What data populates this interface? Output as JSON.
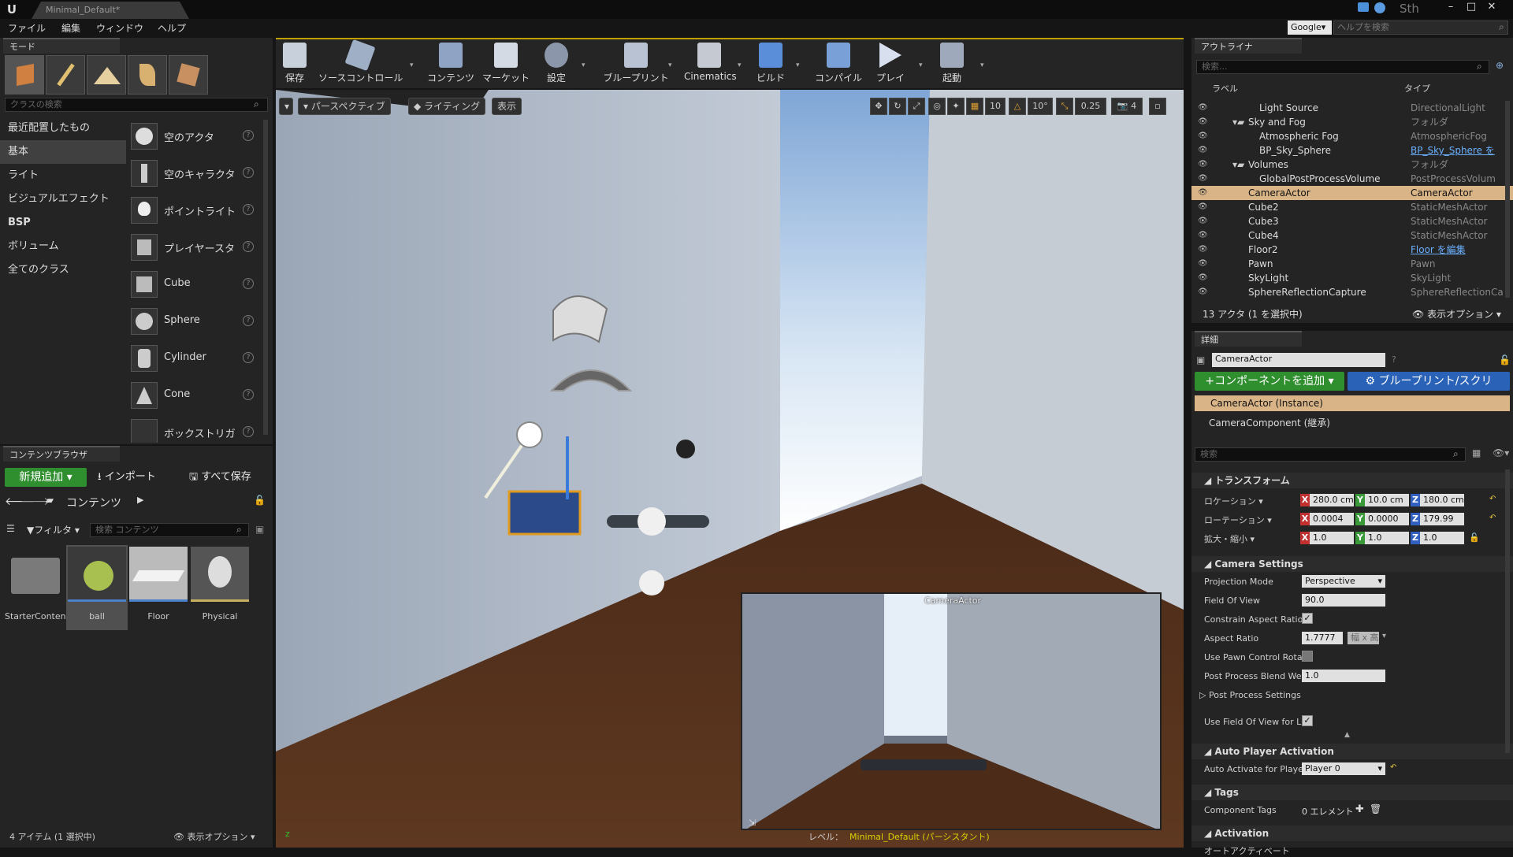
{
  "titlebar": {
    "tab": "Minimal_Default*",
    "user": "Sth"
  },
  "menu": [
    "ファイル",
    "編集",
    "ウィンドウ",
    "ヘルプ"
  ],
  "search_engine": "Google▾",
  "help_search_placeholder": "ヘルプを検索",
  "modes": {
    "tab": "モード",
    "class_search_placeholder": "クラスの検索",
    "categories": [
      "最近配置したもの",
      "基本",
      "ライト",
      "ビジュアルエフェクト",
      "BSP",
      "ボリューム",
      "全てのクラス"
    ],
    "items": [
      "空のアクタ",
      "空のキャラクタ",
      "ポイントライト",
      "プレイヤースタ",
      "Cube",
      "Sphere",
      "Cylinder",
      "Cone",
      "ボックストリガ"
    ]
  },
  "content_browser": {
    "tab": "コンテンツブラウザ",
    "add_new": "新規追加",
    "import": "インポート",
    "save_all": "すべて保存",
    "path": "コンテンツ",
    "filter": "フィルタ",
    "search_placeholder": "検索 コンテンツ",
    "assets": [
      "StarterContent",
      "ball",
      "Floor",
      "Physical"
    ],
    "status": "4 アイテム (1 選択中)",
    "view_options": "表示オプション"
  },
  "toolbar": [
    "保存",
    "ソースコントロール",
    "コンテンツ",
    "マーケット",
    "設定",
    "ブループリント",
    "Cinematics",
    "ビルド",
    "コンパイル",
    "プレイ",
    "起動"
  ],
  "viewport": {
    "perspective": "パースペクティブ",
    "lighting": "ライティング",
    "show": "表示",
    "grid": "10",
    "angle": "10°",
    "scale": "0.25",
    "camera_speed": "4",
    "pip_title": "CameraActor",
    "level_label": "レベル：",
    "level_name": "Minimal_Default (パーシスタント)"
  },
  "outliner": {
    "tab": "アウトライナ",
    "search_placeholder": "検索...",
    "col_label": "ラベル",
    "col_type": "タイプ",
    "rows": [
      {
        "name": "Light Source",
        "type": "DirectionalLight"
      },
      {
        "name": "Sky and Fog",
        "type": "フォルダ"
      },
      {
        "name": "Atmospheric Fog",
        "type": "AtmosphericFog"
      },
      {
        "name": "BP_Sky_Sphere",
        "type": "BP_Sky_Sphere を"
      },
      {
        "name": "Volumes",
        "type": "フォルダ"
      },
      {
        "name": "GlobalPostProcessVolume",
        "type": "PostProcessVolum"
      },
      {
        "name": "CameraActor",
        "type": "CameraActor"
      },
      {
        "name": "Cube2",
        "type": "StaticMeshActor"
      },
      {
        "name": "Cube3",
        "type": "StaticMeshActor"
      },
      {
        "name": "Cube4",
        "type": "StaticMeshActor"
      },
      {
        "name": "Floor2",
        "type": "Floor を編集"
      },
      {
        "name": "Pawn",
        "type": "Pawn"
      },
      {
        "name": "SkyLight",
        "type": "SkyLight"
      },
      {
        "name": "SphereReflectionCapture",
        "type": "SphereReflectionCa"
      }
    ],
    "status": "13 アクタ (1 を選択中)",
    "view_options": "表示オプション"
  },
  "details": {
    "tab": "詳細",
    "actor_name": "CameraActor",
    "add_component": "コンポーネントを追加",
    "blueprint": "ブループリント/スクリ",
    "instance": "CameraActor (Instance)",
    "component": "CameraComponent (継承)",
    "search_placeholder": "検索",
    "transform": {
      "title": "トランスフォーム",
      "location_label": "ロケーション",
      "rotation_label": "ローテーション",
      "scale_label": "拡大・縮小",
      "location": [
        "280.0 cm",
        "10.0 cm",
        "180.0 cm"
      ],
      "rotation": [
        "0.0004",
        "0.0000",
        "179.99"
      ],
      "scale": [
        "1.0",
        "1.0",
        "1.0"
      ]
    },
    "camera": {
      "title": "Camera Settings",
      "projection_label": "Projection Mode",
      "projection": "Perspective",
      "fov_label": "Field Of View",
      "fov": "90.0",
      "constrain_label": "Constrain Aspect Ratio",
      "aspect_label": "Aspect Ratio",
      "aspect": "1.7777",
      "aspect_unit": "幅 x 高",
      "pawn_label": "Use Pawn Control Rotat",
      "blend_label": "Post Process Blend Wei",
      "blend": "1.0",
      "pps_label": "Post Process Settings",
      "fov_lod_label": "Use Field Of View for LC"
    },
    "auto_player": {
      "title": "Auto Player Activation",
      "label": "Auto Activate for Player",
      "value": "Player 0"
    },
    "tags": {
      "title": "Tags",
      "label": "Component Tags",
      "value": "0 エレメント"
    },
    "activation": {
      "title": "Activation",
      "label": "オートアクティベート"
    }
  }
}
